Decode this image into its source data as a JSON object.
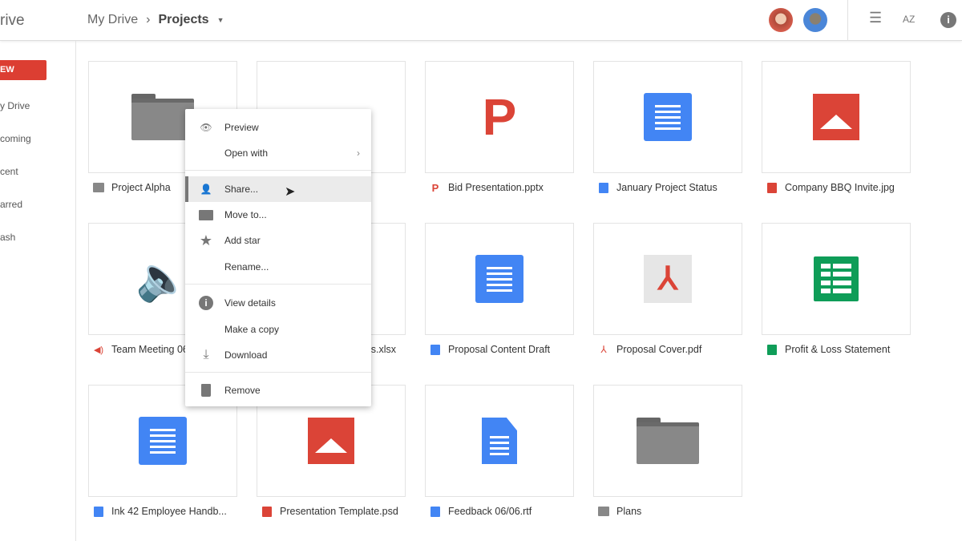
{
  "header": {
    "logo_fragment": "rive",
    "breadcrumb_root": "My Drive",
    "breadcrumb_current": "Projects"
  },
  "sidebar": {
    "new_label": "EW",
    "items": [
      "y Drive",
      "coming",
      "cent",
      "arred",
      "ash"
    ]
  },
  "colors": {
    "new": "#dc3e32",
    "docs": "#4285f4",
    "sheets": "#0f9d58",
    "red": "#db4437",
    "folder": "#8a8a8a"
  },
  "files": [
    {
      "name": "Project Alpha",
      "type": "folder"
    },
    {
      "name": "",
      "type": "word"
    },
    {
      "name": "Bid Presentation.pptx",
      "type": "pptx"
    },
    {
      "name": "January Project Status",
      "type": "doc"
    },
    {
      "name": "Company BBQ Invite.jpg",
      "type": "image"
    },
    {
      "name": "Team Meeting 06",
      "type": "audio"
    },
    {
      "name": "s.xlsx",
      "type": "xlsx"
    },
    {
      "name": "Proposal Content Draft",
      "type": "doc"
    },
    {
      "name": "Proposal Cover.pdf",
      "type": "pdf"
    },
    {
      "name": "Profit & Loss Statement",
      "type": "sheet"
    },
    {
      "name": "Ink 42 Employee Handb...",
      "type": "doc"
    },
    {
      "name": "Presentation Template.psd",
      "type": "image"
    },
    {
      "name": "Feedback 06/06.rtf",
      "type": "rtf"
    },
    {
      "name": "Plans",
      "type": "folder"
    }
  ],
  "menu": {
    "items": [
      "Preview",
      "Open with",
      "Share...",
      "Move to...",
      "Add star",
      "Rename...",
      "View details",
      "Make a copy",
      "Download",
      "Remove"
    ]
  }
}
